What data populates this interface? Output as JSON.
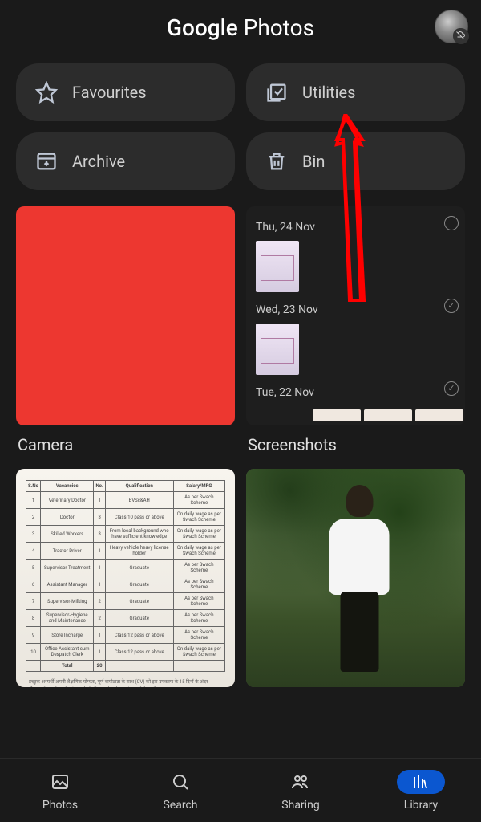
{
  "header": {
    "title_brand": "Google",
    "title_app": "Photos"
  },
  "quick": [
    {
      "label": "Favourites",
      "icon": "star"
    },
    {
      "label": "Utilities",
      "icon": "check-square"
    },
    {
      "label": "Archive",
      "icon": "archive"
    },
    {
      "label": "Bin",
      "icon": "trash"
    }
  ],
  "albums": [
    {
      "label": "Camera"
    },
    {
      "label": "Screenshots"
    }
  ],
  "screenshots_dates": [
    "Thu, 24 Nov",
    "Wed, 23 Nov",
    "Tue, 22 Nov"
  ],
  "doc_headers": [
    "S.No",
    "Vacancies",
    "No.",
    "Qualification",
    "Salary/MRG"
  ],
  "doc_rows": [
    [
      "1",
      "Veterinary Doctor",
      "1",
      "BVSc&AH",
      "As per Swach Scheme"
    ],
    [
      "2",
      "Doctor",
      "3",
      "Class 10 pass or above",
      "On daily wage as per Swach Scheme"
    ],
    [
      "3",
      "Skilled Workers",
      "3",
      "From local background who have sufficient knowledge",
      "On daily wage as per Swach Scheme"
    ],
    [
      "4",
      "Tractor Driver",
      "1",
      "Heavy vehicle heavy license holder",
      "On daily wage as per Swach Scheme"
    ],
    [
      "5",
      "Supervisor-Treatment",
      "1",
      "Graduate",
      "As per Swach Scheme"
    ],
    [
      "6",
      "Assistant Manager",
      "1",
      "Graduate",
      "As per Swach Scheme"
    ],
    [
      "7",
      "Supervisor-Milking",
      "2",
      "Graduate",
      "As per Swach Scheme"
    ],
    [
      "8",
      "Supervisor-Hygiene and Maintenance",
      "2",
      "Graduate",
      "As per Swach Scheme"
    ],
    [
      "9",
      "Store Incharge",
      "1",
      "Class 12 pass or above",
      "As per Swach Scheme"
    ],
    [
      "10",
      "Office Assistant cum Despatch Clerk",
      "1",
      "Class 12 pass or above",
      "On daily wage as per Swach Scheme"
    ],
    [
      "",
      "Total",
      "20",
      "",
      ""
    ]
  ],
  "nav": [
    {
      "label": "Photos",
      "icon": "photo"
    },
    {
      "label": "Search",
      "icon": "search"
    },
    {
      "label": "Sharing",
      "icon": "people"
    },
    {
      "label": "Library",
      "icon": "library",
      "active": true
    }
  ]
}
